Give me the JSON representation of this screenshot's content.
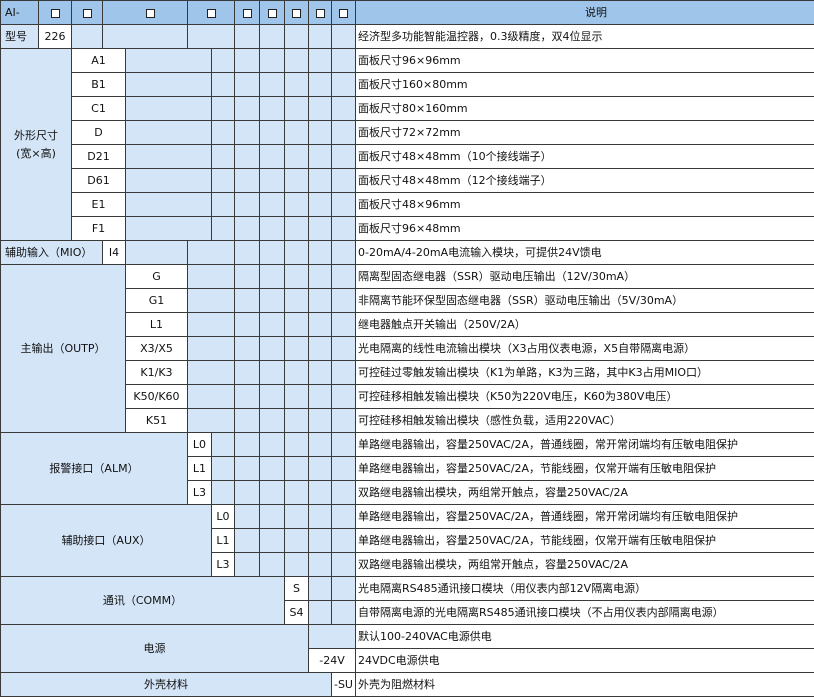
{
  "header": {
    "prefix": "AI-",
    "title": "说明"
  },
  "model": {
    "label": "型号",
    "value": "226",
    "desc": "经济型多功能智能温控器，0.3级精度，双4位显示"
  },
  "dimensions": {
    "label_line1": "外形尺寸",
    "label_line2": "(宽×高)",
    "rows": [
      {
        "code": "A1",
        "desc": "面板尺寸96×96mm"
      },
      {
        "code": "B1",
        "desc": "面板尺寸160×80mm"
      },
      {
        "code": "C1",
        "desc": "面板尺寸80×160mm"
      },
      {
        "code": "D",
        "desc": "面板尺寸72×72mm"
      },
      {
        "code": "D21",
        "desc": "面板尺寸48×48mm（10个接线端子）"
      },
      {
        "code": "D61",
        "desc": "面板尺寸48×48mm（12个接线端子）"
      },
      {
        "code": "E1",
        "desc": "面板尺寸48×96mm"
      },
      {
        "code": "F1",
        "desc": "面板尺寸96×48mm"
      }
    ]
  },
  "mio": {
    "label": "辅助输入（MIO）",
    "code": "I4",
    "desc": "0-20mA/4-20mA电流输入模块，可提供24V馈电"
  },
  "outp": {
    "label": "主输出（OUTP）",
    "rows": [
      {
        "code": "G",
        "desc": "隔离型固态继电器（SSR）驱动电压输出（12V/30mA）"
      },
      {
        "code": "G1",
        "desc": "非隔离节能环保型固态继电器（SSR）驱动电压输出（5V/30mA）"
      },
      {
        "code": "L1",
        "desc": "继电器触点开关输出（250V/2A）"
      },
      {
        "code": "X3/X5",
        "desc": "光电隔离的线性电流输出模块（X3占用仪表电源，X5自带隔离电源）"
      },
      {
        "code": "K1/K3",
        "desc": "可控硅过零触发输出模块（K1为单路，K3为三路，其中K3占用MIO口）"
      },
      {
        "code": "K50/K60",
        "desc": "可控硅移相触发输出模块（K50为220V电压，K60为380V电压）"
      },
      {
        "code": "K51",
        "desc": "可控硅移相触发输出模块（感性负载，适用220VAC）"
      }
    ]
  },
  "alm": {
    "label": "报警接口（ALM）",
    "rows": [
      {
        "code": "L0",
        "desc": "单路继电器输出，容量250VAC/2A，普通线圈，常开常闭端均有压敏电阻保护"
      },
      {
        "code": "L1",
        "desc": "单路继电器输出，容量250VAC/2A，节能线圈，仅常开端有压敏电阻保护"
      },
      {
        "code": "L3",
        "desc": "双路继电器输出模块，两组常开触点，容量250VAC/2A"
      }
    ]
  },
  "aux": {
    "label": "辅助接口（AUX）",
    "rows": [
      {
        "code": "L0",
        "desc": "单路继电器输出，容量250VAC/2A，普通线圈，常开常闭端均有压敏电阻保护"
      },
      {
        "code": "L1",
        "desc": "单路继电器输出，容量250VAC/2A，节能线圈，仅常开端有压敏电阻保护"
      },
      {
        "code": "L3",
        "desc": "双路继电器输出模块，两组常开触点，容量250VAC/2A"
      }
    ]
  },
  "comm": {
    "label": "通讯（COMM）",
    "rows": [
      {
        "code": "S",
        "desc": "光电隔离RS485通讯接口模块（用仪表内部12V隔离电源）"
      },
      {
        "code": "S4",
        "desc": "自带隔离电源的光电隔离RS485通讯接口模块（不占用仪表内部隔离电源）"
      }
    ]
  },
  "power": {
    "label": "电源",
    "rows": [
      {
        "code": "",
        "desc": "默认100-240VAC电源供电"
      },
      {
        "code": "-24V",
        "desc": "24VDC电源供电"
      }
    ]
  },
  "shell": {
    "label": "外壳材料",
    "code": "-SU",
    "desc": "外壳为阻燃材料"
  }
}
